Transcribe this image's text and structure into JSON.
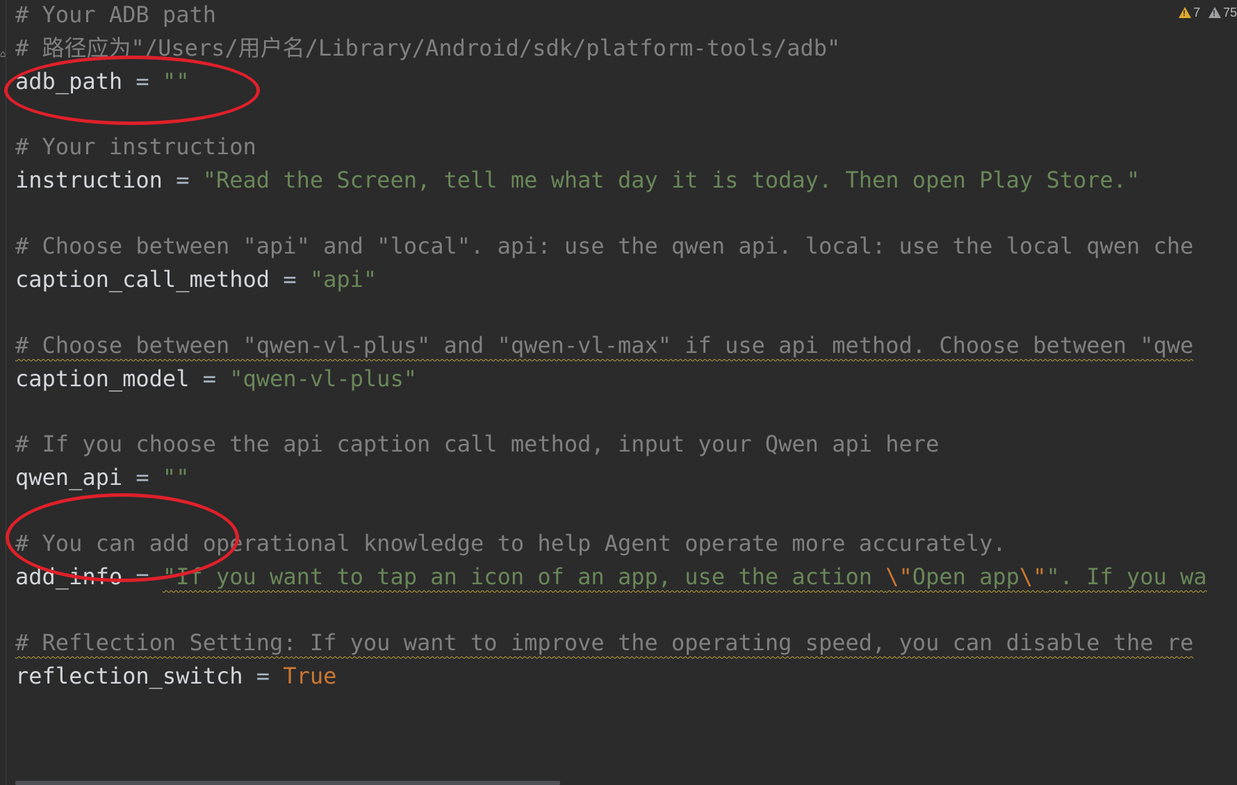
{
  "editor": {
    "indicators": {
      "warnings": "7",
      "weak_warnings": "75"
    },
    "lines": {
      "l1": "# Your ADB path",
      "l2": "# 路径应为\"/Users/用户名/Library/Android/sdk/platform-tools/adb\"",
      "l3_name": "adb_path",
      "l3_eq": " = ",
      "l3_val": "\"\"",
      "l5": "# Your instruction",
      "l6_name": "instruction",
      "l6_eq": " = ",
      "l6_val": "\"Read the Screen, tell me what day it is today. Then open Play Store.\"",
      "l8": "# Choose between \"api\" and \"local\". api: use the qwen api. local: use the local qwen che",
      "l9_name": "caption_call_method",
      "l9_eq": " = ",
      "l9_val": "\"api\"",
      "l11": "# Choose between \"qwen-vl-plus\" and \"qwen-vl-max\" if use api method. Choose between \"qwe",
      "l12_name": "caption_model",
      "l12_eq": " = ",
      "l12_val": "\"qwen-vl-plus\"",
      "l14": "# If you choose the api caption call method, input your Qwen api here",
      "l15_name": "qwen_api",
      "l15_eq": " = ",
      "l15_val": "\"\"",
      "l17": "# You can add operational knowledge to help Agent operate more accurately.",
      "l18_name": "add_info",
      "l18_eq": " = ",
      "l18_val_a": "\"If you want to tap an icon of an app, use the action ",
      "l18_esc1": "\\\"",
      "l18_val_b": "Open app",
      "l18_esc2": "\\\"",
      "l18_val_c": "\". If you wa",
      "l20": "# Reflection Setting: If you want to improve the operating speed, you can disable the re",
      "l21_name": "reflection_switch",
      "l21_eq": " = ",
      "l21_val": "True"
    },
    "annotation_color": "#e0202a"
  }
}
